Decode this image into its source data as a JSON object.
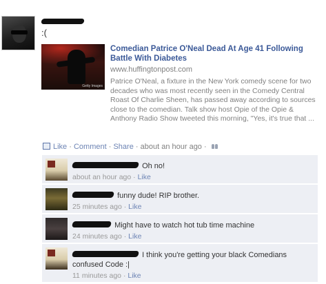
{
  "post": {
    "author_avatar_icon": "profile-photo-icon",
    "status_text": ":(",
    "link": {
      "thumbnail_icon": "article-thumbnail-image",
      "thumbnail_credit": "Getty Images",
      "title": "Comedian Patrice O'Neal Dead At Age 41 Following Battle With Diabetes",
      "url": "www.huffingtonpost.com",
      "description": "Patrice O'Neal, a fixture in the New York comedy scene for two decades who was most recently seen in the Comedy Central Roast Of Charlie Sheen, has passed away according to sources close to the comedian. Talk show host Opie of the Opie & Anthony Radio Show tweeted this morning, \"Yes, it's true that ..."
    },
    "actions": {
      "like_label": "Like",
      "comment_label": "Comment",
      "share_label": "Share",
      "timestamp": "about an hour ago",
      "separator": "·",
      "audience_icon": "friends-audience-icon"
    }
  },
  "comments": [
    {
      "text": "Oh no!",
      "timestamp": "about an hour ago",
      "like_label": "Like",
      "avatar_icon": "commenter-avatar-icon"
    },
    {
      "text": "funny dude! RIP brother.",
      "timestamp": "25 minutes ago",
      "like_label": "Like",
      "avatar_icon": "commenter-avatar-icon"
    },
    {
      "text": "Might have to watch hot tub time machine",
      "timestamp": "24 minutes ago",
      "like_label": "Like",
      "avatar_icon": "commenter-avatar-icon"
    },
    {
      "text": "I think you're getting your black Comedians confused Code :|",
      "timestamp": "11 minutes ago",
      "like_label": "Like",
      "avatar_icon": "commenter-avatar-icon"
    }
  ],
  "colors": {
    "link_blue": "#3b5998",
    "action_blue": "#6d84b4",
    "comment_bg": "#edeff4",
    "muted_gray": "#808080"
  }
}
